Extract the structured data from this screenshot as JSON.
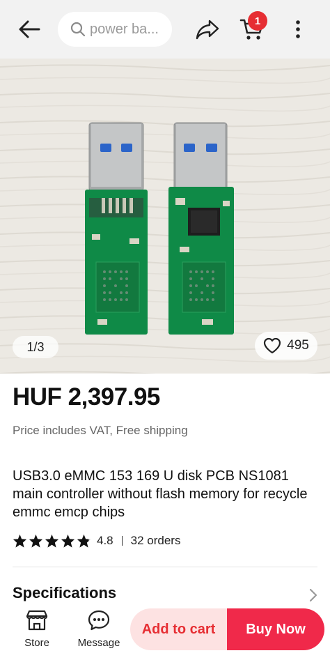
{
  "header": {
    "search_placeholder": "power ba...",
    "cart_count": "1"
  },
  "gallery": {
    "counter": "1/3",
    "favorites": "495"
  },
  "product": {
    "price": "HUF 2,397.95",
    "vat_note": "Price includes VAT, Free shipping",
    "title": "USB3.0 eMMC 153 169 U disk PCB NS1081 main controller without flash memory for recycle emmc emcp chips",
    "rating": "4.8",
    "rating_stars": 4.8,
    "orders": "32 orders"
  },
  "sections": {
    "specifications": "Specifications"
  },
  "bottom_bar": {
    "store_label": "Store",
    "message_label": "Message",
    "add_to_cart": "Add to cart",
    "buy_now": "Buy Now"
  },
  "colors": {
    "accent": "#f0294a",
    "accent_soft": "#fde2e2",
    "badge": "#e62e33"
  }
}
